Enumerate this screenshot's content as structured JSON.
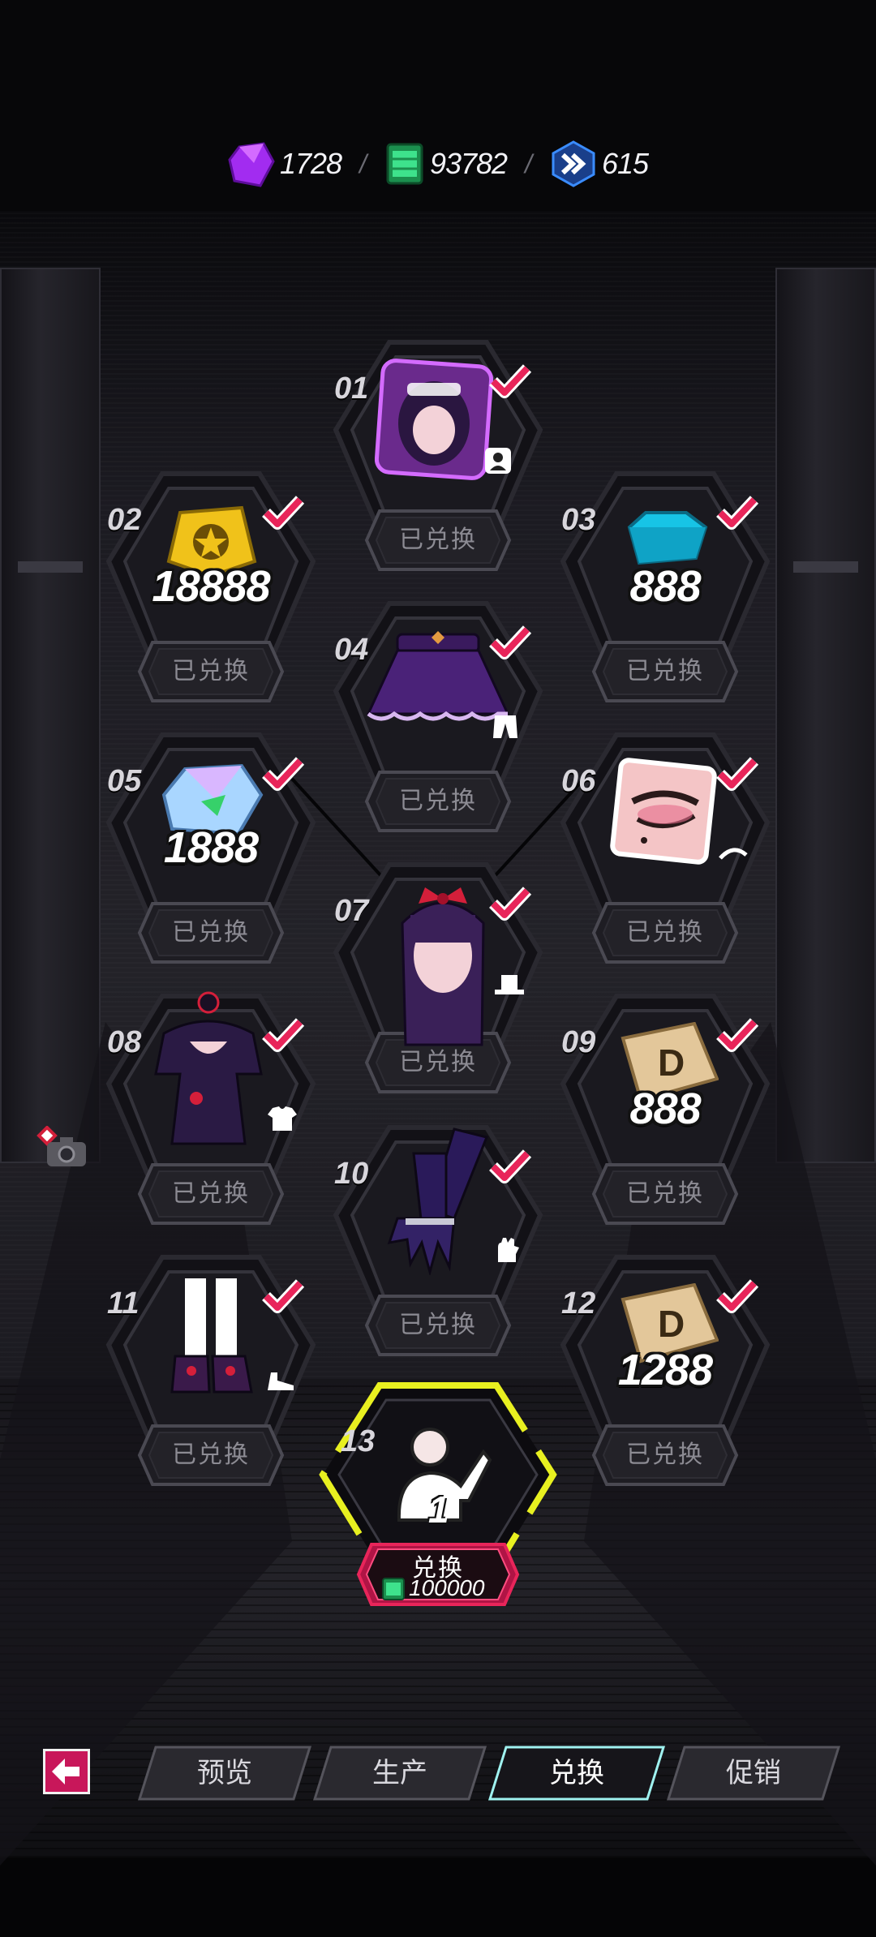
{
  "currencies": [
    {
      "icon": "purple-crystal-icon",
      "value": "1728",
      "color": "#a22cf0"
    },
    {
      "icon": "green-ticket-icon",
      "value": "93782",
      "color": "#2ed07a"
    },
    {
      "icon": "blue-chevron-badge-icon",
      "value": "615",
      "color": "#2f7cf0"
    }
  ],
  "currency_separator": "/",
  "rewards": [
    {
      "num": "01",
      "amount": "",
      "button": "已兑换",
      "art": "portrait-frame-icon",
      "type_icon": "avatar-type-icon",
      "redeemed": true
    },
    {
      "num": "02",
      "amount": "18888",
      "button": "已兑换",
      "art": "gold-star-coin-icon",
      "type_icon": "",
      "redeemed": true
    },
    {
      "num": "03",
      "amount": "888",
      "button": "已兑换",
      "art": "blue-gem-icon",
      "type_icon": "",
      "redeemed": true
    },
    {
      "num": "04",
      "amount": "",
      "button": "已兑换",
      "art": "purple-skirt-icon",
      "type_icon": "bottoms-type-icon",
      "redeemed": true
    },
    {
      "num": "05",
      "amount": "1888",
      "button": "已兑换",
      "art": "crystal-shard-icon",
      "type_icon": "",
      "redeemed": true
    },
    {
      "num": "06",
      "amount": "",
      "button": "已兑换",
      "art": "eye-makeup-icon",
      "type_icon": "eyebrow-type-icon",
      "redeemed": true
    },
    {
      "num": "07",
      "amount": "",
      "button": "已兑换",
      "art": "hairstyle-icon",
      "type_icon": "hat-type-icon",
      "redeemed": true
    },
    {
      "num": "08",
      "amount": "",
      "button": "已兑换",
      "art": "dress-top-icon",
      "type_icon": "shirt-type-icon",
      "redeemed": true
    },
    {
      "num": "09",
      "amount": "888",
      "button": "已兑换",
      "art": "d-ticket-icon",
      "type_icon": "",
      "redeemed": true
    },
    {
      "num": "10",
      "amount": "",
      "button": "已兑换",
      "art": "gloves-icon",
      "type_icon": "glove-type-icon",
      "redeemed": true
    },
    {
      "num": "11",
      "amount": "",
      "button": "已兑换",
      "art": "platform-shoes-icon",
      "type_icon": "shoe-type-icon",
      "redeemed": true
    },
    {
      "num": "12",
      "amount": "1288",
      "button": "已兑换",
      "art": "d-ticket-icon",
      "type_icon": "",
      "redeemed": true
    }
  ],
  "final_reward": {
    "num": "13",
    "art": "pose-emote-icon",
    "badge": "1",
    "button": "兑换",
    "cost": "100000",
    "cost_icon": "green-ticket-icon"
  },
  "nav": {
    "back_icon": "back-arrow-icon",
    "tabs": [
      {
        "label": "预览",
        "active": false
      },
      {
        "label": "生产",
        "active": false
      },
      {
        "label": "兑换",
        "active": true
      },
      {
        "label": "促销",
        "active": false
      }
    ]
  },
  "colors": {
    "accent_red": "#e8255a",
    "accent_yellow": "#e8f020",
    "tab_active": "#9ff2f0"
  }
}
